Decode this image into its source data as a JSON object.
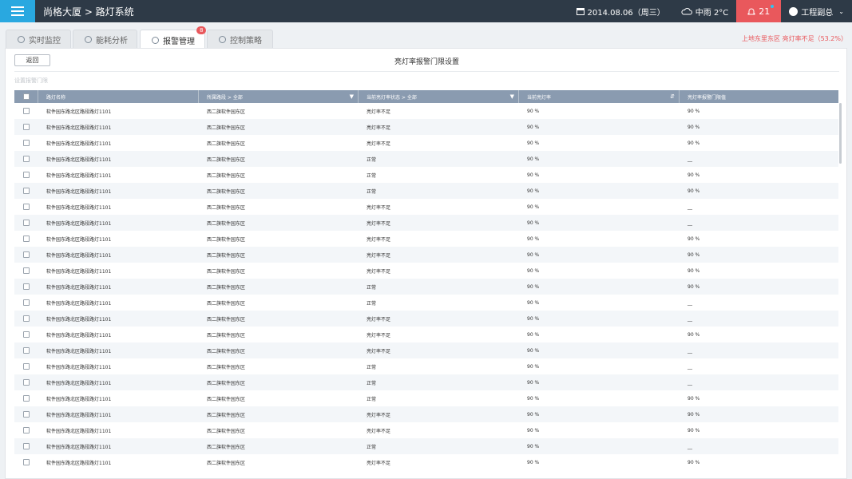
{
  "header": {
    "title": "尚格大厦 > 路灯系统",
    "date": "2014.08.06（周三）",
    "weather": "中雨  2°C",
    "alarm_count": "21",
    "user": "工程副总"
  },
  "tabs": [
    {
      "label": "实时监控"
    },
    {
      "label": "能耗分析"
    },
    {
      "label": "报警管理",
      "badge": "8"
    },
    {
      "label": "控制策略"
    }
  ],
  "alert_message": "上地东里东区  亮灯率不足（53.2%）",
  "panel": {
    "back_label": "返回",
    "title": "亮灯率报警门限设置",
    "sub_label": "设置报警门限"
  },
  "table": {
    "columns": [
      "路灯名称",
      "所属路段 > 全部",
      "当前亮灯率状态 > 全部",
      "当前亮灯率",
      "亮灯率报警门限值"
    ],
    "rows": [
      [
        "软件园东路北区路段路灯1101",
        "西二旗软件园东区",
        "亮灯率不足",
        "90  %",
        "90  %"
      ],
      [
        "软件园东路北区路段路灯1101",
        "西二旗软件园东区",
        "亮灯率不足",
        "90  %",
        "90  %"
      ],
      [
        "软件园东路北区路段路灯1101",
        "西二旗软件园东区",
        "亮灯率不足",
        "90  %",
        "90  %"
      ],
      [
        "软件园东路北区路段路灯1101",
        "西二旗软件园东区",
        "正常",
        "90  %",
        "__"
      ],
      [
        "软件园东路北区路段路灯1101",
        "西二旗软件园东区",
        "正常",
        "90  %",
        "90  %"
      ],
      [
        "软件园东路北区路段路灯1101",
        "西二旗软件园东区",
        "正常",
        "90  %",
        "90  %"
      ],
      [
        "软件园东路北区路段路灯1101",
        "西二旗软件园东区",
        "亮灯率不足",
        "90  %",
        "__"
      ],
      [
        "软件园东路北区路段路灯1101",
        "西二旗软件园东区",
        "亮灯率不足",
        "90  %",
        "__"
      ],
      [
        "软件园东路北区路段路灯1101",
        "西二旗软件园东区",
        "亮灯率不足",
        "90  %",
        "90  %"
      ],
      [
        "软件园东路北区路段路灯1101",
        "西二旗软件园东区",
        "亮灯率不足",
        "90  %",
        "90  %"
      ],
      [
        "软件园东路北区路段路灯1101",
        "西二旗软件园东区",
        "亮灯率不足",
        "90  %",
        "90  %"
      ],
      [
        "软件园东路北区路段路灯1101",
        "西二旗软件园东区",
        "正常",
        "90  %",
        "90  %"
      ],
      [
        "软件园东路北区路段路灯1101",
        "西二旗软件园东区",
        "正常",
        "90  %",
        "__"
      ],
      [
        "软件园东路北区路段路灯1101",
        "西二旗软件园东区",
        "亮灯率不足",
        "90  %",
        "__"
      ],
      [
        "软件园东路北区路段路灯1101",
        "西二旗软件园东区",
        "亮灯率不足",
        "90  %",
        "90  %"
      ],
      [
        "软件园东路北区路段路灯1101",
        "西二旗软件园东区",
        "亮灯率不足",
        "90  %",
        "__"
      ],
      [
        "软件园东路北区路段路灯1101",
        "西二旗软件园东区",
        "正常",
        "90  %",
        "__"
      ],
      [
        "软件园东路北区路段路灯1101",
        "西二旗软件园东区",
        "正常",
        "90  %",
        "__"
      ],
      [
        "软件园东路北区路段路灯1101",
        "西二旗软件园东区",
        "正常",
        "90  %",
        "90  %"
      ],
      [
        "软件园东路北区路段路灯1101",
        "西二旗软件园东区",
        "亮灯率不足",
        "90  %",
        "90  %"
      ],
      [
        "软件园东路北区路段路灯1101",
        "西二旗软件园东区",
        "亮灯率不足",
        "90  %",
        "90  %"
      ],
      [
        "软件园东路北区路段路灯1101",
        "西二旗软件园东区",
        "正常",
        "90  %",
        "__"
      ],
      [
        "软件园东路北区路段路灯1101",
        "西二旗软件园东区",
        "亮灯率不足",
        "90  %",
        "90  %"
      ]
    ]
  },
  "colors": {
    "topbar": "#2e3a47",
    "menu_button": "#29a8e0",
    "alarm": "#e9585c",
    "table_header": "#8a9bb0"
  }
}
